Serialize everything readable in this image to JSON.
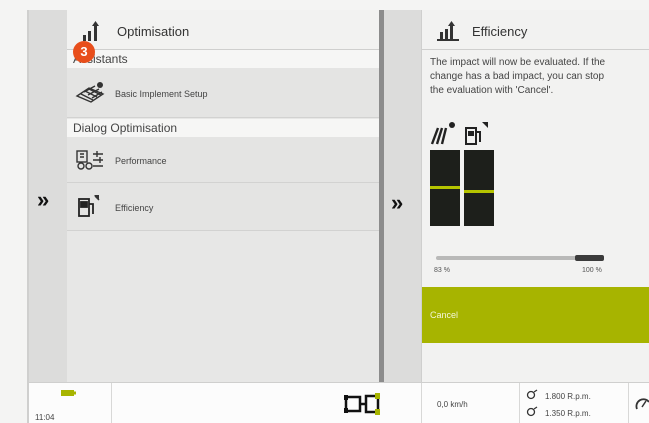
{
  "left_panel": {
    "title": "Optimisation",
    "badge": "3",
    "sections": [
      {
        "label": "Assistants",
        "items": [
          {
            "label": "Basic Implement Setup",
            "icon": "implement-setup-icon"
          }
        ]
      },
      {
        "label": "Dialog Optimisation",
        "items": [
          {
            "label": "Performance",
            "icon": "performance-icon"
          },
          {
            "label": "Efficiency",
            "icon": "efficiency-fuel-icon"
          }
        ]
      }
    ]
  },
  "right_panel": {
    "title": "Efficiency",
    "description_lines": [
      "The impact will now be evaluated. If the",
      "change has a bad impact, you can stop",
      "the evaluation with 'Cancel'."
    ],
    "slider": {
      "min_label": "83 %",
      "max_label": "100 %",
      "value_fraction": 0.83
    },
    "cancel_label": "Cancel",
    "accent_color": "#a7b400"
  },
  "status_bar": {
    "time": "11:04",
    "speed": "0,0 km/h",
    "rpm_top": "1.800 R.p.m.",
    "rpm_bottom": "1.350 R.p.m."
  }
}
